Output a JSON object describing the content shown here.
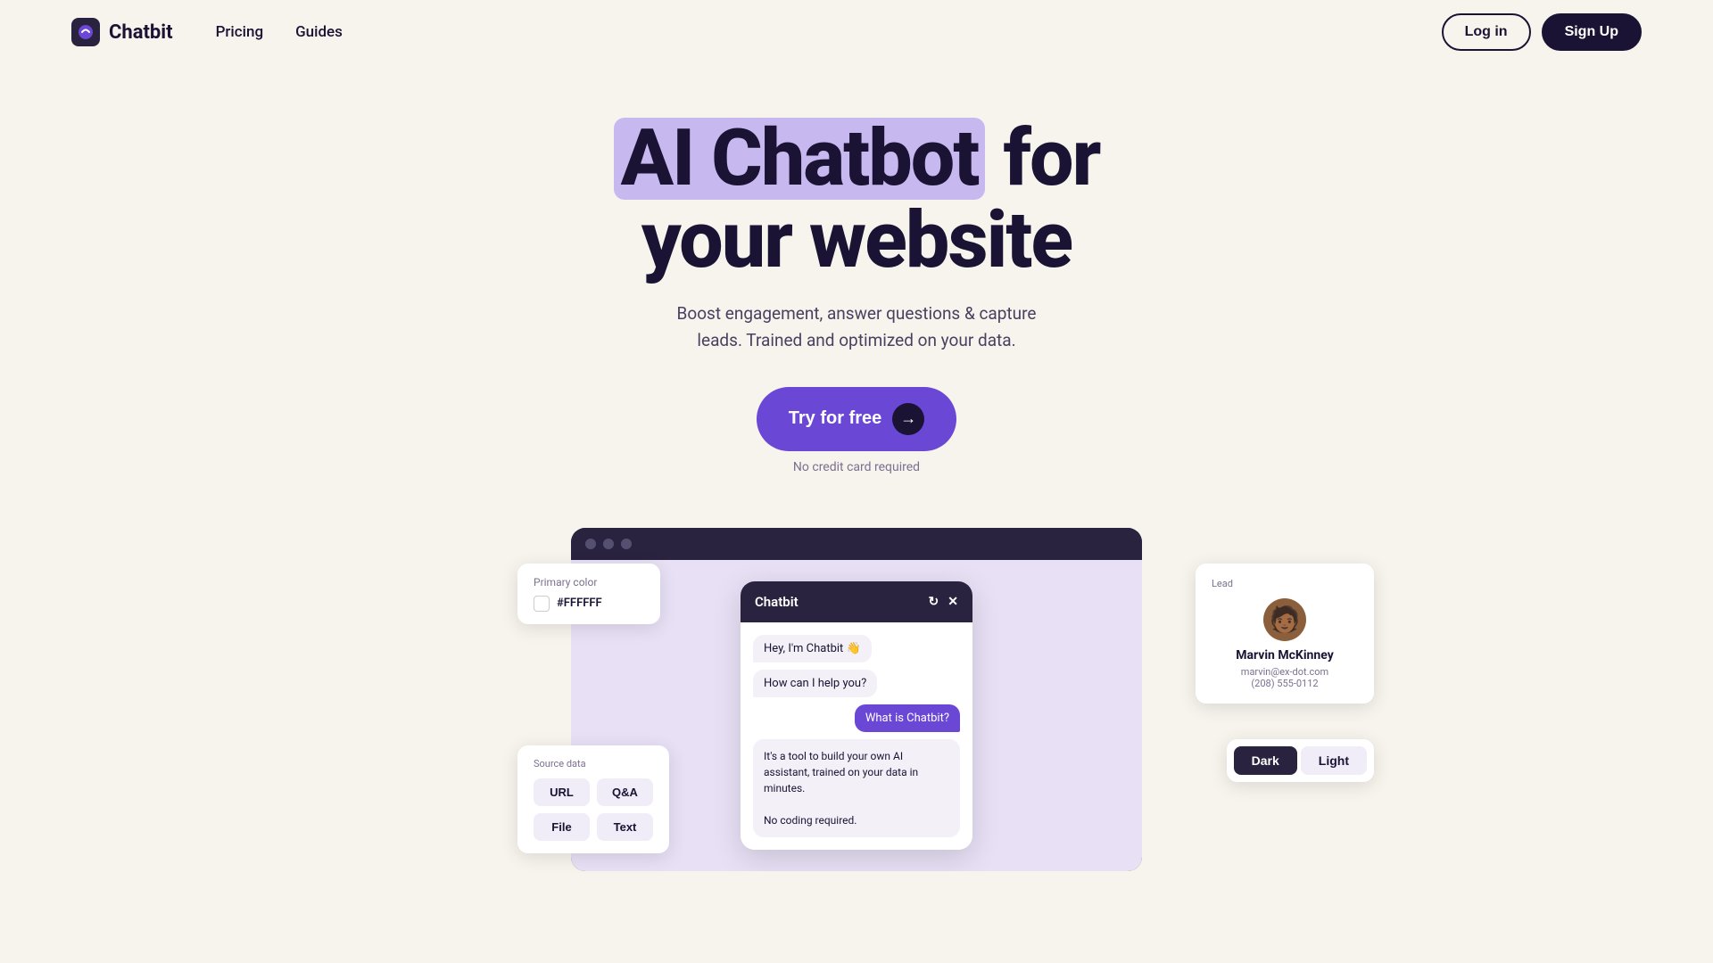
{
  "nav": {
    "logo_text": "Chatbit",
    "links": [
      {
        "label": "Pricing",
        "href": "#"
      },
      {
        "label": "Guides",
        "href": "#"
      }
    ],
    "login_label": "Log in",
    "signup_label": "Sign Up"
  },
  "hero": {
    "title_part1": "AI Chatbot",
    "title_part2": "for",
    "title_part3": "your website",
    "subtitle": "Boost engagement, answer questions & capture\nleads. Trained and optimized on your data.",
    "cta_label": "Try for free",
    "no_cc": "No credit card required"
  },
  "demo": {
    "chat_title": "Chatbit",
    "bot_greeting": "Hey, I'm Chatbit 👋",
    "bot_help": "How can I help you?",
    "user_question": "What is Chatbit?",
    "bot_answer": "It's a tool to build your own AI assistant, trained on your data in minutes.\n\nNo coding required.",
    "primary_color_label": "Primary color",
    "primary_color_value": "#FFFFFF",
    "source_data_label": "Source data",
    "source_buttons": [
      "URL",
      "Q&A",
      "File",
      "Text"
    ],
    "lead_label": "Lead",
    "lead_name": "Marvin McKinney",
    "lead_email": "marvin@ex-dot.com",
    "lead_phone": "(208) 555-0112",
    "theme_dark": "Dark",
    "theme_light": "Light"
  },
  "colors": {
    "accent_purple": "#6b47d6",
    "dark": "#1a1333",
    "background": "#f7f3ed"
  }
}
